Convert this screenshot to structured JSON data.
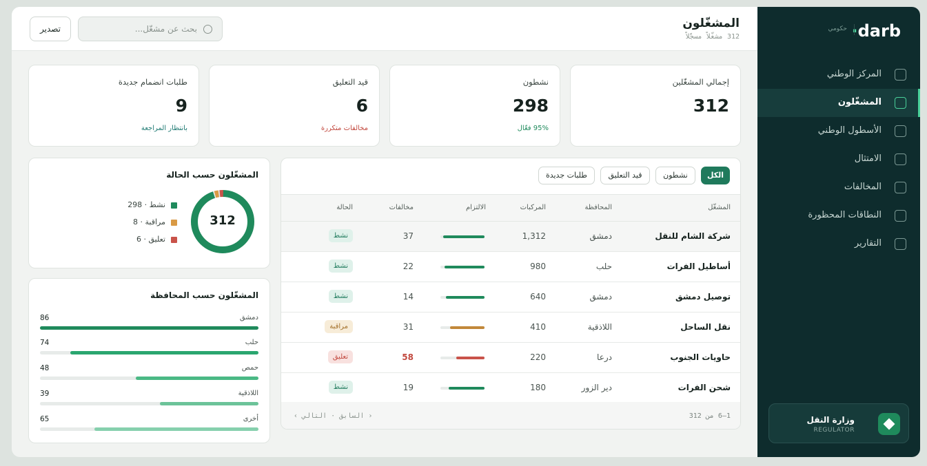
{
  "header": {
    "title": "المشغّلون",
    "subtitle": "312 مشغّلاً مسجّلاً",
    "search_placeholder": "بحث عن مشغّل...",
    "export_label": "تصدير"
  },
  "kpis": [
    {
      "label": "إجمالي المشغّلين",
      "value": "312",
      "sub": ""
    },
    {
      "label": "نشطون",
      "value": "298",
      "sub": "95% فعّال"
    },
    {
      "label": "قيد التعليق",
      "value": "6",
      "sub": "مخالفات متكررة"
    },
    {
      "label": "طلبات انضمام جديدة",
      "value": "9",
      "sub": "بانتظار المراجعة"
    }
  ],
  "filters": [
    "الكل",
    "نشطون",
    "قيد التعليق",
    "طلبات جديدة"
  ],
  "table": {
    "headers": [
      "المشغّل",
      "المحافظة",
      "المركبات",
      "الالتزام",
      "مخالفات",
      "الحالة"
    ],
    "rows": [
      {
        "name": "شركة الشام للنقل",
        "province": "دمشق",
        "vehicles": "1,312",
        "compliance": 0.94,
        "violations": "37",
        "status": "نشط"
      },
      {
        "name": "أساطيل الفرات",
        "province": "حلب",
        "vehicles": "980",
        "compliance": 0.91,
        "violations": "22",
        "status": "نشط"
      },
      {
        "name": "توصيل دمشق",
        "province": "دمشق",
        "vehicles": "640",
        "compliance": 0.88,
        "violations": "14",
        "status": "نشط"
      },
      {
        "name": "نقل الساحل",
        "province": "اللاذقية",
        "vehicles": "410",
        "compliance": 0.78,
        "violations": "31",
        "status": "مراقبة"
      },
      {
        "name": "حاويات الجنوب",
        "province": "درعا",
        "vehicles": "220",
        "compliance": 0.64,
        "violations": "58",
        "status": "تعليق"
      },
      {
        "name": "شحن الفرات",
        "province": "دير الزور",
        "vehicles": "180",
        "compliance": 0.82,
        "violations": "19",
        "status": "نشط"
      }
    ],
    "footer_count": "1–6 من 312",
    "pagination": "‹ السابق · التالي ›"
  },
  "status_chart": {
    "title": "المشغّلون حسب الحالة",
    "total": "312",
    "items": [
      {
        "label": "نشط · 298",
        "value": 298,
        "color": "#1f8a5c"
      },
      {
        "label": "مراقبة · 8",
        "value": 8,
        "color": "#d99a45"
      },
      {
        "label": "تعليق · 6",
        "value": 6,
        "color": "#c9534a"
      }
    ]
  },
  "province_chart": {
    "title": "المشغّلون حسب المحافظة",
    "items": [
      {
        "name": "دمشق",
        "value": "86",
        "fraction": 1.0,
        "color": "#1f8a5c"
      },
      {
        "name": "حلب",
        "value": "74",
        "fraction": 0.86,
        "color": "#2aa66f"
      },
      {
        "name": "حمص",
        "value": "48",
        "fraction": 0.56,
        "color": "#4ab985"
      },
      {
        "name": "اللاذقية",
        "value": "39",
        "fraction": 0.45,
        "color": "#6cc399"
      },
      {
        "name": "أخرى",
        "value": "65",
        "fraction": 0.75,
        "color": "#86d0ad"
      }
    ]
  },
  "sidebar": {
    "brand": "darb",
    "brand_tag": "حكومي",
    "items": [
      {
        "label": "المركز الوطني",
        "active": false
      },
      {
        "label": "المشغّلون",
        "active": true
      },
      {
        "label": "الأسطول الوطني",
        "active": false
      },
      {
        "label": "الامتثال",
        "active": false
      },
      {
        "label": "المخالفات",
        "active": false
      },
      {
        "label": "النطاقات المحظورة",
        "active": false
      },
      {
        "label": "التقارير",
        "active": false
      }
    ],
    "org_name": "وزارة النقل",
    "org_role": "REGULATOR"
  }
}
